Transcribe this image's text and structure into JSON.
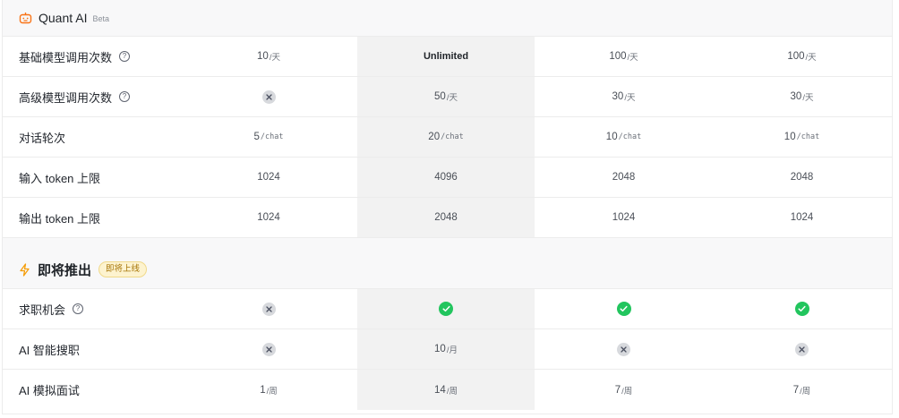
{
  "header": {
    "title": "Quant AI",
    "badge": "Beta"
  },
  "rows": [
    {
      "label": "基础模型调用次数",
      "help": true,
      "cells": [
        {
          "kind": "value",
          "num": "10",
          "unit": "/天"
        },
        {
          "kind": "bold",
          "text": "Unlimited"
        },
        {
          "kind": "value",
          "num": "100",
          "unit": "/天"
        },
        {
          "kind": "value",
          "num": "100",
          "unit": "/天"
        }
      ]
    },
    {
      "label": "高级模型调用次数",
      "help": true,
      "cells": [
        {
          "kind": "x"
        },
        {
          "kind": "value",
          "num": "50",
          "unit": "/天"
        },
        {
          "kind": "value",
          "num": "30",
          "unit": "/天"
        },
        {
          "kind": "value",
          "num": "30",
          "unit": "/天"
        }
      ]
    },
    {
      "label": "对话轮次",
      "help": false,
      "cells": [
        {
          "kind": "value",
          "num": "5",
          "unit": "/chat",
          "mono": true
        },
        {
          "kind": "value",
          "num": "20",
          "unit": "/chat",
          "mono": true
        },
        {
          "kind": "value",
          "num": "10",
          "unit": "/chat",
          "mono": true
        },
        {
          "kind": "value",
          "num": "10",
          "unit": "/chat",
          "mono": true
        }
      ]
    },
    {
      "label": "输入 token 上限",
      "help": false,
      "cells": [
        {
          "kind": "value",
          "num": "1024",
          "unit": ""
        },
        {
          "kind": "value",
          "num": "4096",
          "unit": ""
        },
        {
          "kind": "value",
          "num": "2048",
          "unit": ""
        },
        {
          "kind": "value",
          "num": "2048",
          "unit": ""
        }
      ]
    },
    {
      "label": "输出 token 上限",
      "help": false,
      "cells": [
        {
          "kind": "value",
          "num": "1024",
          "unit": ""
        },
        {
          "kind": "value",
          "num": "2048",
          "unit": ""
        },
        {
          "kind": "value",
          "num": "1024",
          "unit": ""
        },
        {
          "kind": "value",
          "num": "1024",
          "unit": ""
        }
      ]
    }
  ],
  "soon": {
    "title": "即将推出",
    "badge": "即将上线",
    "rows": [
      {
        "label": "求职机会",
        "help": true,
        "cells": [
          {
            "kind": "x"
          },
          {
            "kind": "ok"
          },
          {
            "kind": "ok"
          },
          {
            "kind": "ok"
          }
        ]
      },
      {
        "label": "AI 智能搜职",
        "help": false,
        "cells": [
          {
            "kind": "x"
          },
          {
            "kind": "value",
            "num": "10",
            "unit": "/月"
          },
          {
            "kind": "x"
          },
          {
            "kind": "x"
          }
        ]
      },
      {
        "label": "AI 模拟面试",
        "help": false,
        "cells": [
          {
            "kind": "value",
            "num": "1",
            "unit": "/周"
          },
          {
            "kind": "value",
            "num": "14",
            "unit": "/周"
          },
          {
            "kind": "value",
            "num": "7",
            "unit": "/周"
          },
          {
            "kind": "value",
            "num": "7",
            "unit": "/周"
          }
        ]
      }
    ]
  },
  "colors": {
    "highlight_column": "#f2f2f2",
    "check": "#22c55e",
    "cross_bg": "#d7d9dd",
    "accent_icon": "#f59e0b"
  }
}
